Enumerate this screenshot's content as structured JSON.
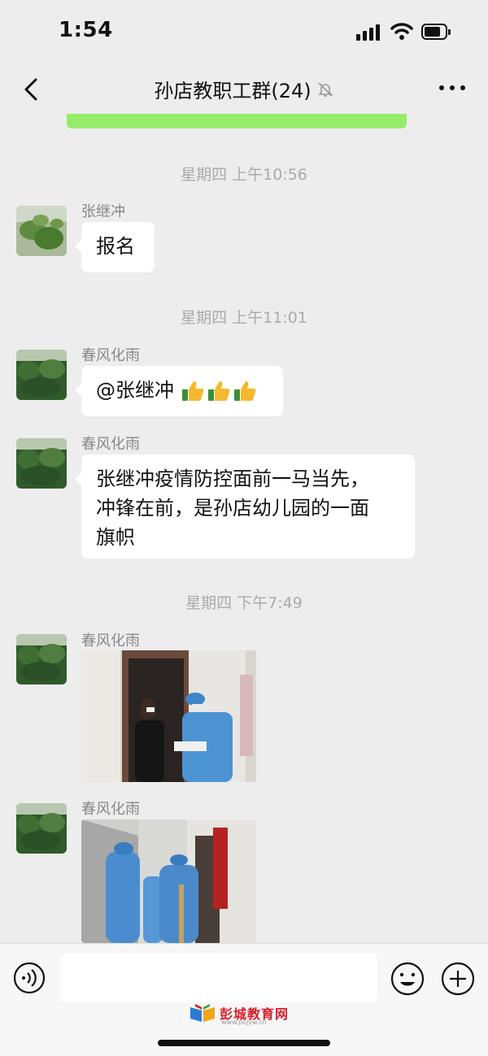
{
  "status_bar": {
    "time": "1:54"
  },
  "header": {
    "title": "孙店教职工群(24)"
  },
  "messages": [
    {
      "timestamp": "星期四 上午10:56",
      "sender": "张继冲",
      "text": "报名"
    },
    {
      "timestamp": "星期四 上午11:01",
      "sender": "春风化雨",
      "text": "@张继冲 "
    },
    {
      "sender": "春风化雨",
      "lines": [
        "张继冲疫情防控面前一马当先，",
        "冲锋在前，是孙店幼儿园的一面",
        "旗帜"
      ]
    },
    {
      "timestamp": "星期四 下午7:49",
      "sender": "春风化雨",
      "type": "image"
    },
    {
      "sender": "春风化雨",
      "type": "image"
    }
  ],
  "input_bar": {
    "placeholder": ""
  },
  "watermark": {
    "text": "彭城教育网",
    "sub": "www.pcjyw.cn"
  },
  "colors": {
    "background": "#ededed",
    "bubble": "#ffffff",
    "green_banner": "#95ec69",
    "watermark_red": "#d81e2b"
  },
  "icons": [
    "back-chevron",
    "mute-bell",
    "more-dots",
    "voice",
    "emoji",
    "plus",
    "thumbs-up"
  ]
}
